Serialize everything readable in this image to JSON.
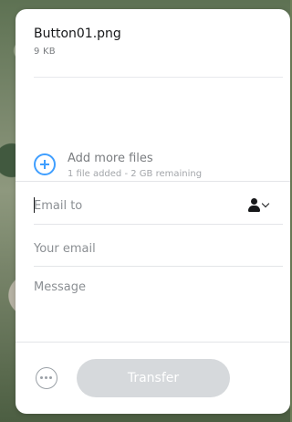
{
  "file": {
    "name": "Button01.png",
    "size": "9 KB"
  },
  "add_files": {
    "label": "Add more files",
    "status": "1 file added - 2 GB remaining"
  },
  "form": {
    "email_to_placeholder": "Email to",
    "your_email_placeholder": "Your email",
    "message_placeholder": "Message"
  },
  "actions": {
    "transfer_label": "Transfer"
  },
  "icons": {
    "add": "plus-circle-icon",
    "contacts": "contacts-icon",
    "more": "more-options-icon"
  },
  "colors": {
    "accent": "#409fff",
    "button_disabled": "#d6d9dc"
  }
}
